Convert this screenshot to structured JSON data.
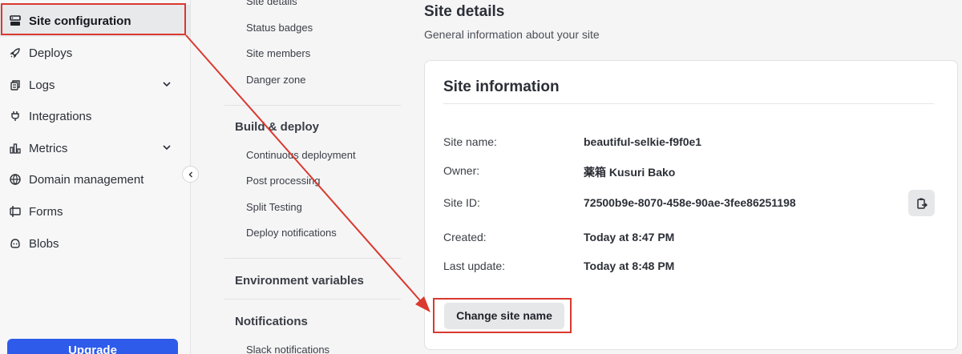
{
  "sidebar": {
    "items": [
      {
        "label": "Site configuration",
        "icon": "server-icon"
      },
      {
        "label": "Deploys",
        "icon": "rocket-icon"
      },
      {
        "label": "Logs",
        "icon": "logs-icon"
      },
      {
        "label": "Integrations",
        "icon": "plug-icon"
      },
      {
        "label": "Metrics",
        "icon": "bar-chart-icon"
      },
      {
        "label": "Domain management",
        "icon": "globe-icon"
      },
      {
        "label": "Forms",
        "icon": "form-icon"
      },
      {
        "label": "Blobs",
        "icon": "blob-icon"
      }
    ],
    "upgrade_label": "Upgrade"
  },
  "subnav": {
    "general_links": [
      "Site details",
      "Status badges",
      "Site members",
      "Danger zone"
    ],
    "build_heading": "Build & deploy",
    "build_links": [
      "Continuous deployment",
      "Post processing",
      "Split Testing",
      "Deploy notifications"
    ],
    "env_heading": "Environment variables",
    "notifications_heading": "Notifications",
    "notifications_links": [
      "Slack notifications"
    ]
  },
  "main": {
    "title": "Site details",
    "subtitle": "General information about your site",
    "card": {
      "title": "Site information",
      "rows": [
        {
          "label": "Site name:",
          "value": "beautiful-selkie-f9f0e1"
        },
        {
          "label": "Owner:",
          "value": "薬箱 Kusuri Bako"
        },
        {
          "label": "Site ID:",
          "value": "72500b9e-8070-458e-90ae-3fee86251198"
        },
        {
          "label": "Created:",
          "value": "Today at 8:47 PM"
        },
        {
          "label": "Last update:",
          "value": "Today at 8:48 PM"
        }
      ],
      "change_button": "Change site name"
    }
  },
  "colors": {
    "accent": "#2e5bea",
    "annotation": "#d9392f"
  }
}
